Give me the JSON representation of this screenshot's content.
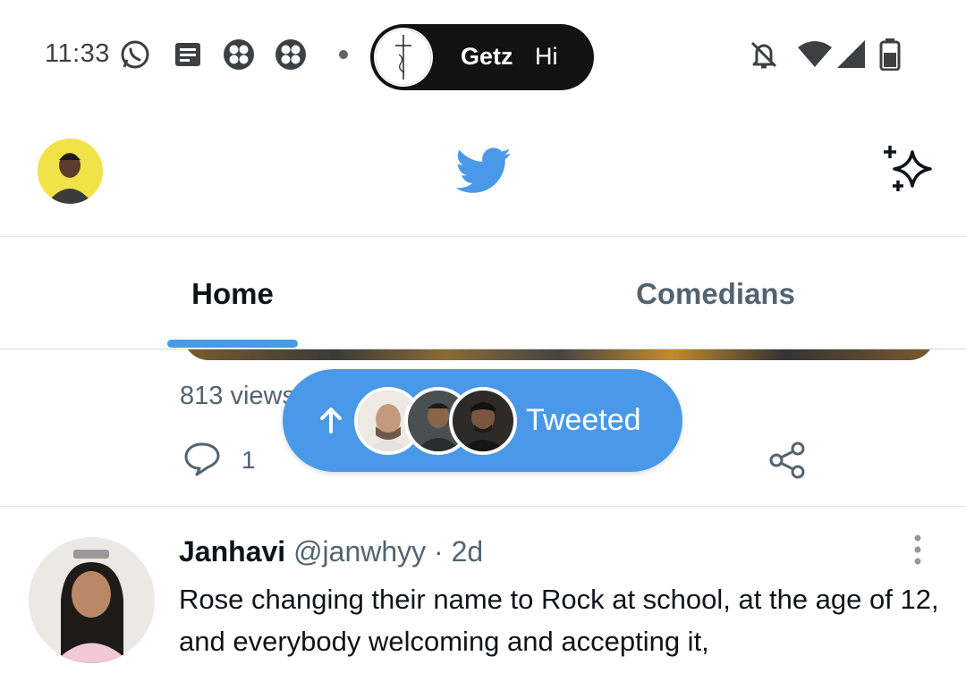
{
  "status_bar": {
    "time": "11:33",
    "icons": [
      "whatsapp-icon",
      "message-icon",
      "app-grid-icon",
      "app-grid-icon",
      "notification-dot"
    ],
    "right_icons": [
      "bell-off-icon",
      "wifi-icon",
      "signal-icon",
      "battery-icon"
    ]
  },
  "chat_bubble": {
    "name": "Getz",
    "message": "Hi"
  },
  "header": {
    "logo": "twitter-bird-icon",
    "right_icon": "sparkle-icon"
  },
  "tabs": [
    {
      "label": "Home",
      "selected": true
    },
    {
      "label": "Comedians",
      "selected": false
    }
  ],
  "previous_tweet": {
    "views": "813 views",
    "reply_count": "1"
  },
  "tweeted_pill": {
    "label": "Tweeted"
  },
  "tweet": {
    "name": "Janhavi",
    "handle": "@janwhyy",
    "separator": "·",
    "time": "2d",
    "text": "Rose changing their name to Rock at school, at the age of 12, and everybody welcoming and accepting it,"
  },
  "colors": {
    "accent": "#4a99e9",
    "text_primary": "#0f1419",
    "text_secondary": "#536471"
  }
}
